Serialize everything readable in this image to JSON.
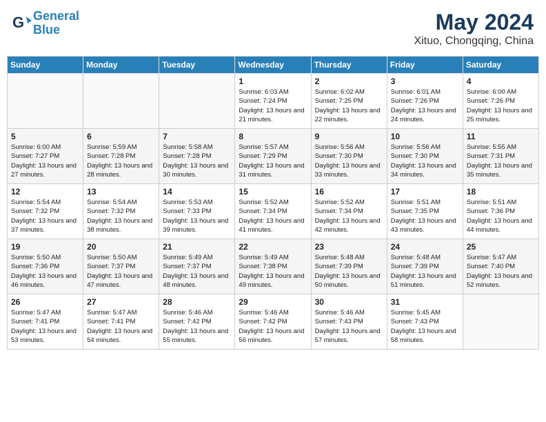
{
  "header": {
    "logo_line1": "General",
    "logo_line2": "Blue",
    "title": "May 2024",
    "subtitle": "Xituo, Chongqing, China"
  },
  "weekdays": [
    "Sunday",
    "Monday",
    "Tuesday",
    "Wednesday",
    "Thursday",
    "Friday",
    "Saturday"
  ],
  "weeks": [
    [
      {
        "day": "",
        "info": ""
      },
      {
        "day": "",
        "info": ""
      },
      {
        "day": "",
        "info": ""
      },
      {
        "day": "1",
        "info": "Sunrise: 6:03 AM\nSunset: 7:24 PM\nDaylight: 13 hours and 21 minutes."
      },
      {
        "day": "2",
        "info": "Sunrise: 6:02 AM\nSunset: 7:25 PM\nDaylight: 13 hours and 22 minutes."
      },
      {
        "day": "3",
        "info": "Sunrise: 6:01 AM\nSunset: 7:26 PM\nDaylight: 13 hours and 24 minutes."
      },
      {
        "day": "4",
        "info": "Sunrise: 6:00 AM\nSunset: 7:26 PM\nDaylight: 13 hours and 25 minutes."
      }
    ],
    [
      {
        "day": "5",
        "info": "Sunrise: 6:00 AM\nSunset: 7:27 PM\nDaylight: 13 hours and 27 minutes."
      },
      {
        "day": "6",
        "info": "Sunrise: 5:59 AM\nSunset: 7:28 PM\nDaylight: 13 hours and 28 minutes."
      },
      {
        "day": "7",
        "info": "Sunrise: 5:58 AM\nSunset: 7:28 PM\nDaylight: 13 hours and 30 minutes."
      },
      {
        "day": "8",
        "info": "Sunrise: 5:57 AM\nSunset: 7:29 PM\nDaylight: 13 hours and 31 minutes."
      },
      {
        "day": "9",
        "info": "Sunrise: 5:56 AM\nSunset: 7:30 PM\nDaylight: 13 hours and 33 minutes."
      },
      {
        "day": "10",
        "info": "Sunrise: 5:56 AM\nSunset: 7:30 PM\nDaylight: 13 hours and 34 minutes."
      },
      {
        "day": "11",
        "info": "Sunrise: 5:55 AM\nSunset: 7:31 PM\nDaylight: 13 hours and 35 minutes."
      }
    ],
    [
      {
        "day": "12",
        "info": "Sunrise: 5:54 AM\nSunset: 7:32 PM\nDaylight: 13 hours and 37 minutes."
      },
      {
        "day": "13",
        "info": "Sunrise: 5:54 AM\nSunset: 7:32 PM\nDaylight: 13 hours and 38 minutes."
      },
      {
        "day": "14",
        "info": "Sunrise: 5:53 AM\nSunset: 7:33 PM\nDaylight: 13 hours and 39 minutes."
      },
      {
        "day": "15",
        "info": "Sunrise: 5:52 AM\nSunset: 7:34 PM\nDaylight: 13 hours and 41 minutes."
      },
      {
        "day": "16",
        "info": "Sunrise: 5:52 AM\nSunset: 7:34 PM\nDaylight: 13 hours and 42 minutes."
      },
      {
        "day": "17",
        "info": "Sunrise: 5:51 AM\nSunset: 7:35 PM\nDaylight: 13 hours and 43 minutes."
      },
      {
        "day": "18",
        "info": "Sunrise: 5:51 AM\nSunset: 7:36 PM\nDaylight: 13 hours and 44 minutes."
      }
    ],
    [
      {
        "day": "19",
        "info": "Sunrise: 5:50 AM\nSunset: 7:36 PM\nDaylight: 13 hours and 46 minutes."
      },
      {
        "day": "20",
        "info": "Sunrise: 5:50 AM\nSunset: 7:37 PM\nDaylight: 13 hours and 47 minutes."
      },
      {
        "day": "21",
        "info": "Sunrise: 5:49 AM\nSunset: 7:37 PM\nDaylight: 13 hours and 48 minutes."
      },
      {
        "day": "22",
        "info": "Sunrise: 5:49 AM\nSunset: 7:38 PM\nDaylight: 13 hours and 49 minutes."
      },
      {
        "day": "23",
        "info": "Sunrise: 5:48 AM\nSunset: 7:39 PM\nDaylight: 13 hours and 50 minutes."
      },
      {
        "day": "24",
        "info": "Sunrise: 5:48 AM\nSunset: 7:39 PM\nDaylight: 13 hours and 51 minutes."
      },
      {
        "day": "25",
        "info": "Sunrise: 5:47 AM\nSunset: 7:40 PM\nDaylight: 13 hours and 52 minutes."
      }
    ],
    [
      {
        "day": "26",
        "info": "Sunrise: 5:47 AM\nSunset: 7:41 PM\nDaylight: 13 hours and 53 minutes."
      },
      {
        "day": "27",
        "info": "Sunrise: 5:47 AM\nSunset: 7:41 PM\nDaylight: 13 hours and 54 minutes."
      },
      {
        "day": "28",
        "info": "Sunrise: 5:46 AM\nSunset: 7:42 PM\nDaylight: 13 hours and 55 minutes."
      },
      {
        "day": "29",
        "info": "Sunrise: 5:46 AM\nSunset: 7:42 PM\nDaylight: 13 hours and 56 minutes."
      },
      {
        "day": "30",
        "info": "Sunrise: 5:46 AM\nSunset: 7:43 PM\nDaylight: 13 hours and 57 minutes."
      },
      {
        "day": "31",
        "info": "Sunrise: 5:45 AM\nSunset: 7:43 PM\nDaylight: 13 hours and 58 minutes."
      },
      {
        "day": "",
        "info": ""
      }
    ]
  ]
}
